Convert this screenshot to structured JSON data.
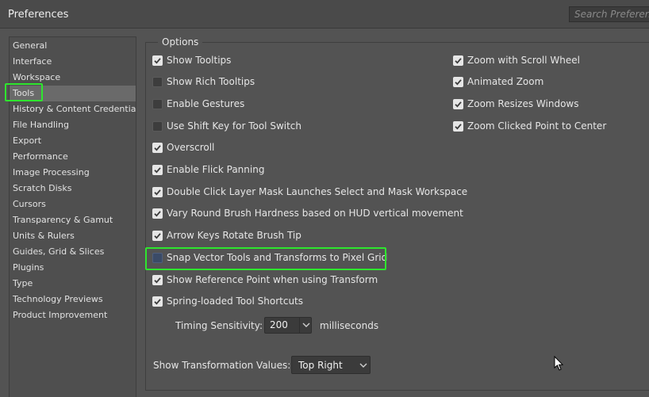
{
  "window": {
    "title": "Preferences",
    "search_placeholder": "Search Preferences"
  },
  "sidebar": {
    "items": [
      {
        "label": "General"
      },
      {
        "label": "Interface"
      },
      {
        "label": "Workspace"
      },
      {
        "label": "Tools",
        "active": true
      },
      {
        "label": "History & Content Credentials"
      },
      {
        "label": "File Handling"
      },
      {
        "label": "Export"
      },
      {
        "label": "Performance"
      },
      {
        "label": "Image Processing"
      },
      {
        "label": "Scratch Disks"
      },
      {
        "label": "Cursors"
      },
      {
        "label": "Transparency & Gamut"
      },
      {
        "label": "Units & Rulers"
      },
      {
        "label": "Guides, Grid & Slices"
      },
      {
        "label": "Plugins"
      },
      {
        "label": "Type"
      },
      {
        "label": "Technology Previews"
      },
      {
        "label": "Product Improvement"
      }
    ]
  },
  "options": {
    "legend": "Options",
    "left": [
      {
        "label": "Show Tooltips",
        "checked": true
      },
      {
        "label": "Show Rich Tooltips",
        "checked": false
      },
      {
        "label": "Enable Gestures",
        "checked": false
      },
      {
        "label": "Use Shift Key for Tool Switch",
        "checked": false
      },
      {
        "label": "Overscroll",
        "checked": true
      },
      {
        "label": "Enable Flick Panning",
        "checked": true
      },
      {
        "label": "Double Click Layer Mask Launches Select and Mask Workspace",
        "checked": true
      },
      {
        "label": "Vary Round Brush Hardness based on HUD vertical movement",
        "checked": true
      },
      {
        "label": "Arrow Keys Rotate Brush Tip",
        "checked": true
      },
      {
        "label": "Snap Vector Tools and Transforms to Pixel Grid",
        "checked": false
      },
      {
        "label": "Show Reference Point when using Transform",
        "checked": true
      },
      {
        "label": "Spring-loaded Tool Shortcuts",
        "checked": true
      }
    ],
    "right": [
      {
        "label": "Zoom with Scroll Wheel",
        "checked": true
      },
      {
        "label": "Animated Zoom",
        "checked": true
      },
      {
        "label": "Zoom Resizes Windows",
        "checked": true
      },
      {
        "label": "Zoom Clicked Point to Center",
        "checked": true
      }
    ],
    "timing": {
      "label": "Timing Sensitivity:",
      "value": "200",
      "unit": "milliseconds"
    },
    "transform_values": {
      "label": "Show Transformation Values:",
      "value": "Top Right"
    }
  },
  "colors": {
    "highlight": "#2ee62e",
    "background": "#535353"
  }
}
